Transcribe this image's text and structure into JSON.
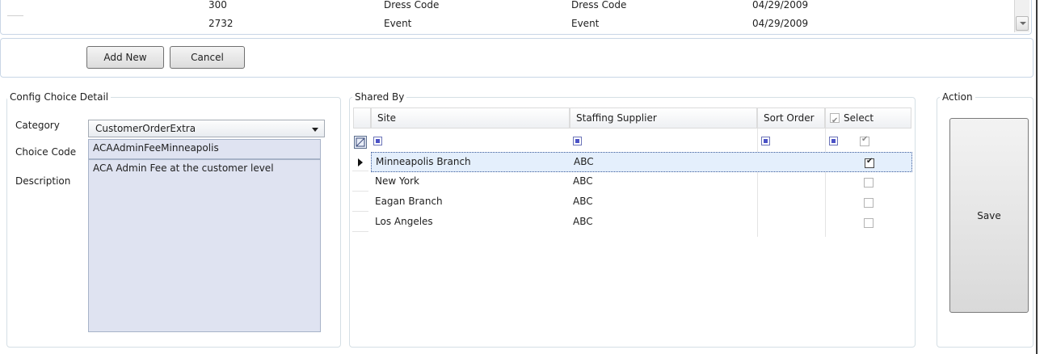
{
  "top_grid": {
    "rows": [
      {
        "id": "300",
        "name": "Dress Code",
        "description": "Dress Code",
        "date": "04/29/2009"
      },
      {
        "id": "2732",
        "name": "Event",
        "description": "Event",
        "date": "04/29/2009"
      }
    ]
  },
  "buttons": {
    "add_new": "Add New",
    "cancel": "Cancel"
  },
  "config_detail": {
    "title": "Config Choice Detail",
    "category_label": "Category",
    "category_value": "CustomerOrderExtra",
    "choice_code_label": "Choice Code",
    "choice_code_value": "ACAAdminFeeMinneapolis",
    "description_label": "Description",
    "description_value": "ACA Admin Fee at the customer level"
  },
  "shared_by": {
    "title": "Shared By",
    "columns": {
      "site": "Site",
      "supplier": "Staffing Supplier",
      "sort": "Sort Order",
      "select": "Select"
    },
    "rows": [
      {
        "site": "Minneapolis Branch",
        "supplier": "ABC",
        "sort_order": "",
        "selected": true
      },
      {
        "site": "New York",
        "supplier": "ABC",
        "sort_order": "",
        "selected": false
      },
      {
        "site": "Eagan Branch",
        "supplier": "ABC",
        "sort_order": "",
        "selected": false
      },
      {
        "site": "Los Angeles",
        "supplier": "ABC",
        "sort_order": "",
        "selected": false
      }
    ]
  },
  "action": {
    "title": "Action",
    "save": "Save"
  }
}
